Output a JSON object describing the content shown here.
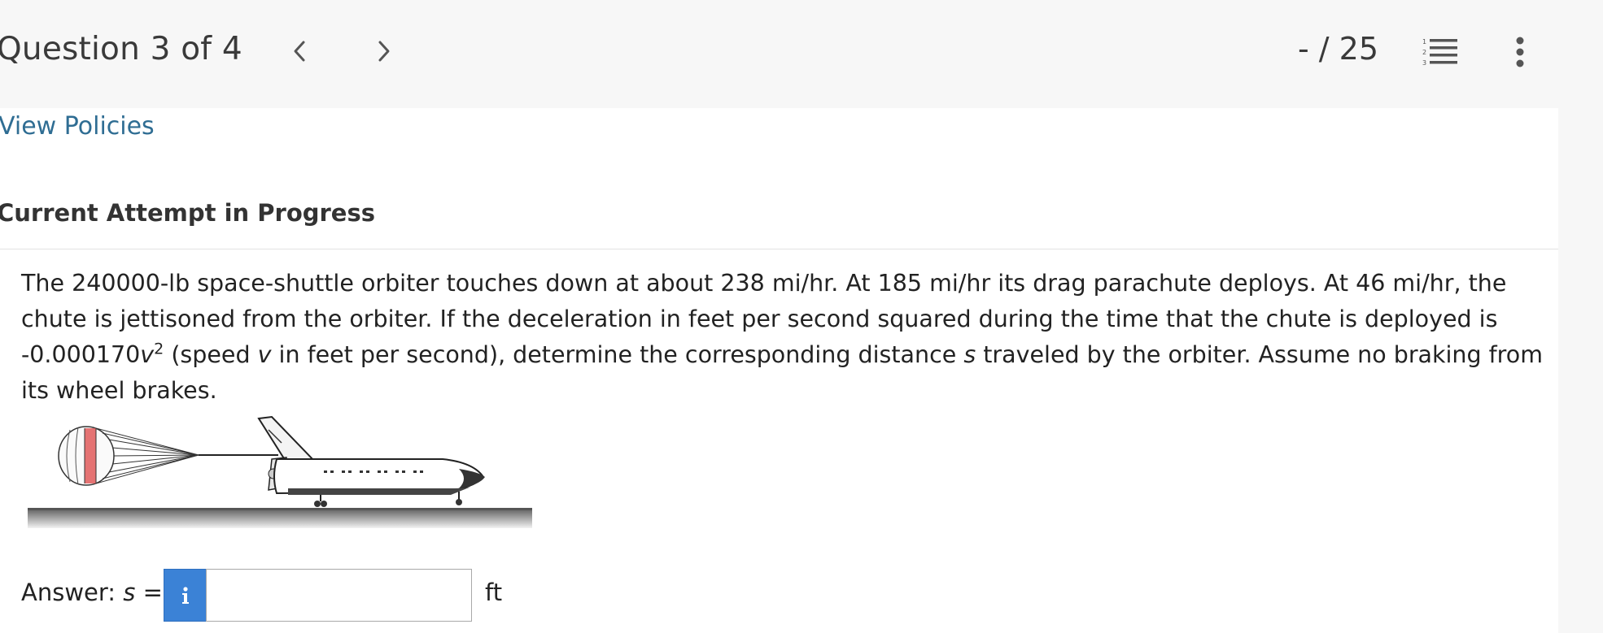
{
  "header": {
    "question_counter": "Question 3 of 4",
    "score": "- / 25",
    "icons": {
      "prev": "chevron-left-icon",
      "next": "chevron-right-icon",
      "list": "numbered-list-icon",
      "more": "kebab-menu-icon"
    }
  },
  "links": {
    "view_policies": "View Policies"
  },
  "attempt": {
    "heading": "Current Attempt in Progress"
  },
  "question": {
    "text_before_exp": "The 240000-lb space-shuttle orbiter touches down at about 238 mi/hr. At 185 mi/hr its drag parachute deploys. At 46 mi/hr, the chute is jettisoned from the orbiter. If the deceleration in feet per second squared during the time that the chute is deployed is -0.000170",
    "var_v": "v",
    "exponent": "2",
    "text_after_exp_1": "(speed ",
    "text_after_exp_2": " in feet per second), determine the corresponding distance ",
    "var_s": "s",
    "text_after_exp_3": " traveled by the orbiter. Assume no braking from its wheel brakes."
  },
  "answer": {
    "label_prefix": "Answer: ",
    "label_var": "s",
    "label_suffix": " =",
    "input_value": "",
    "unit": "ft",
    "info_icon": "info-icon"
  },
  "colors": {
    "link": "#2f6d93",
    "info_button": "#3b82d6",
    "topbar_bg": "#f7f7f7",
    "parachute_stripe": "#e05a5a"
  }
}
